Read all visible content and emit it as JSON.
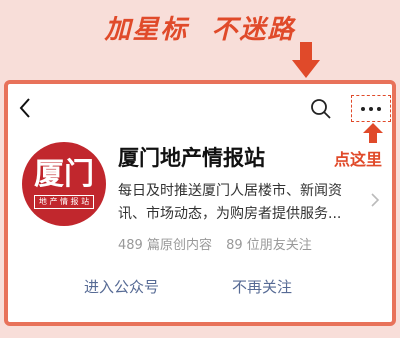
{
  "banner": {
    "part1": "加星标",
    "part2": "不迷路"
  },
  "annotation": {
    "click_here": "点这里"
  },
  "account": {
    "name": "厦门地产情报站",
    "logo_big": "厦门",
    "logo_small": "地 产 情 报 站",
    "description": "每日及时推送厦门人居楼市、新闻资讯、市场动态，为购房者提供服务...",
    "original_count": "489 篇原创内容",
    "friends_follow": "89 位朋友关注"
  },
  "actions": {
    "enter": "进入公众号",
    "unfollow": "不再关注"
  },
  "icons": {
    "back": "back-icon",
    "search": "search-icon",
    "more": "more-icon",
    "chevron": "chevron-right-icon"
  },
  "colors": {
    "accent": "#e04a2a",
    "frame": "#e8725a",
    "background": "#f8ded9",
    "logo": "#c1272d",
    "link": "#576b95"
  }
}
